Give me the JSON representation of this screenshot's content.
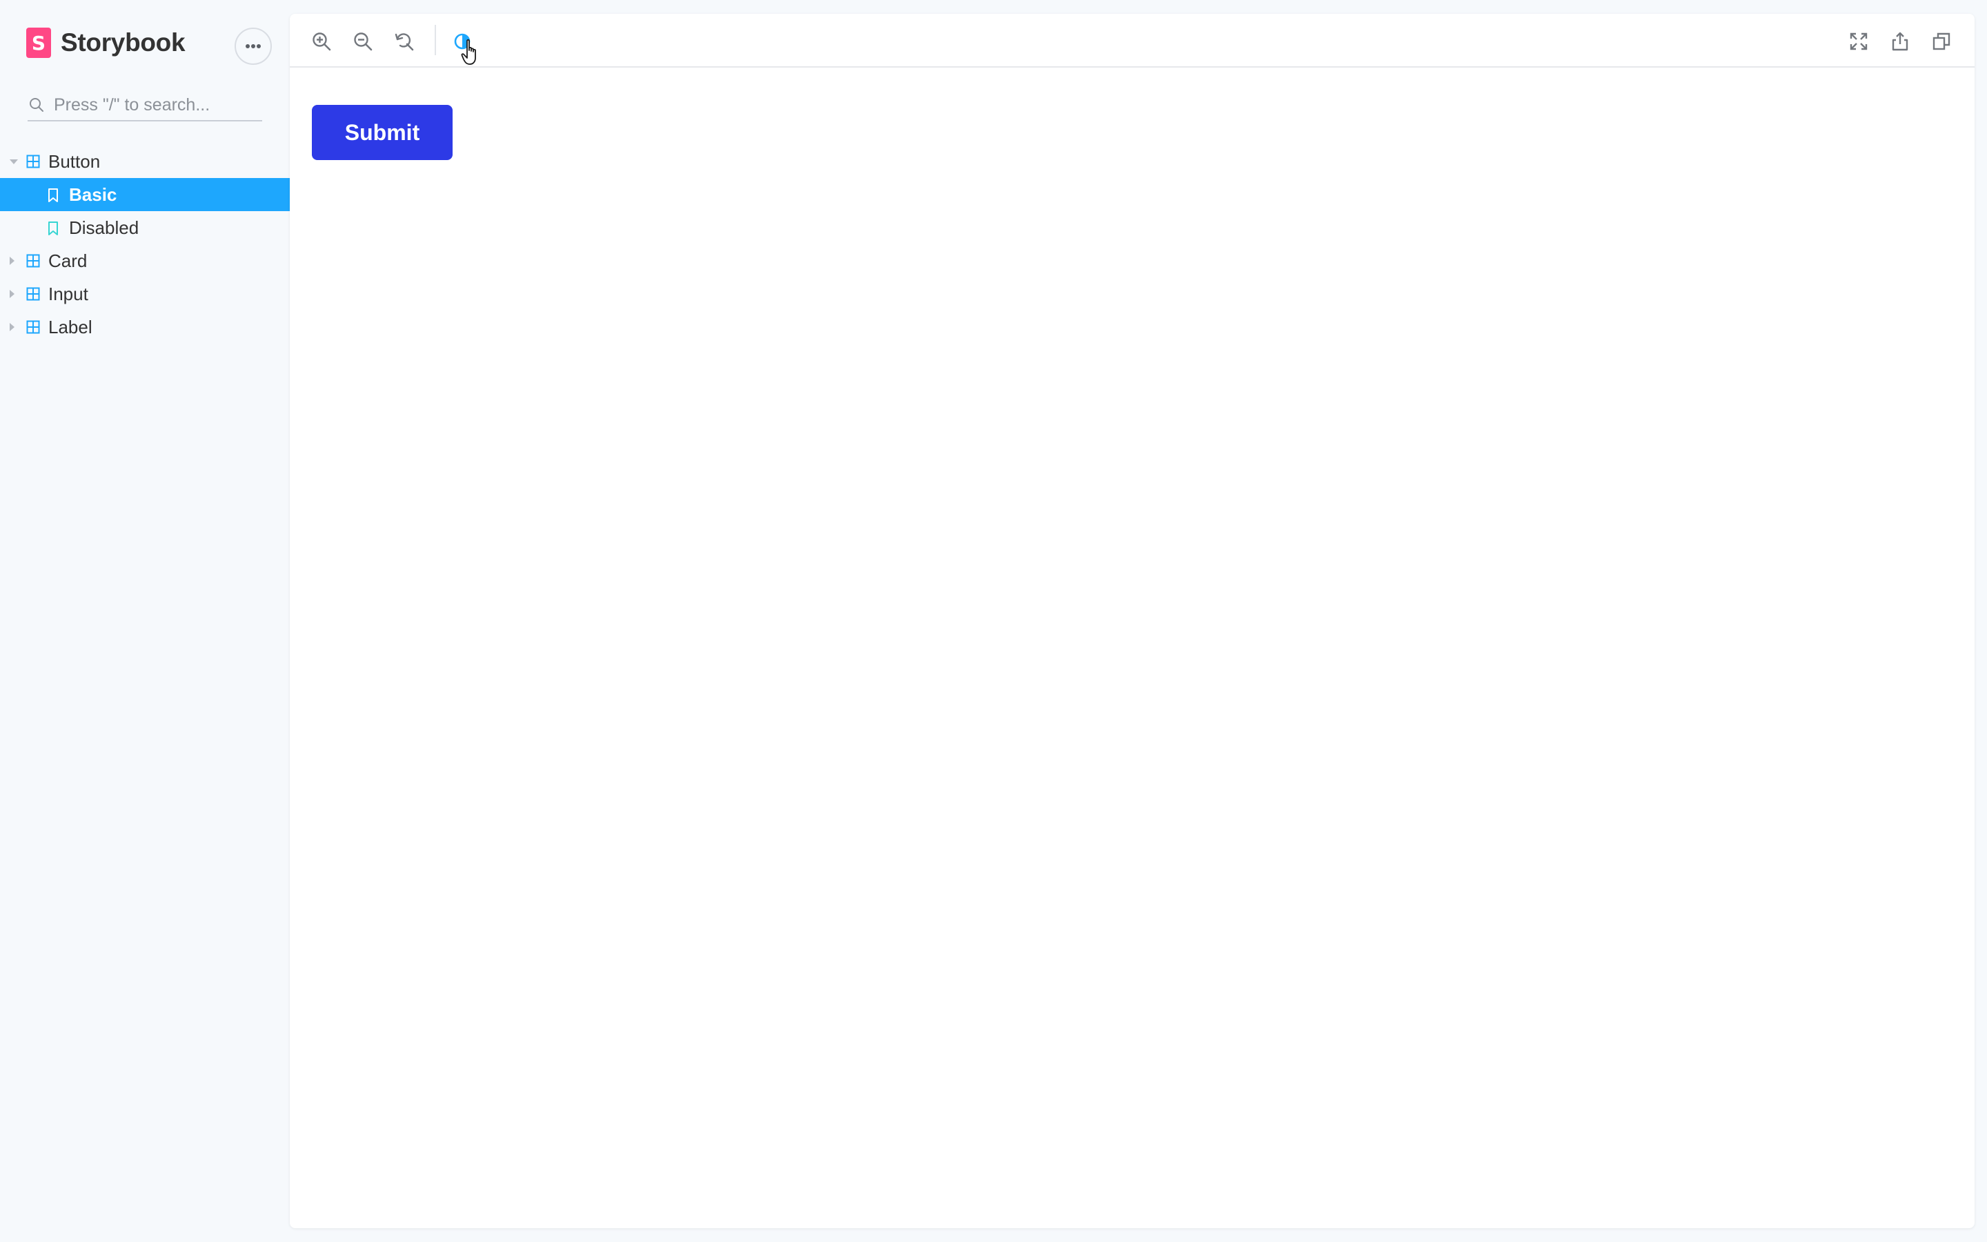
{
  "app": {
    "brand_name": "Storybook",
    "brand_logo_letter": "S"
  },
  "colors": {
    "brand": "#ff4785",
    "accent": "#1ea7fd",
    "component_icon": "#1ea7fd",
    "story_icon": "#37d5d3",
    "submit_button": "#2d3ae6"
  },
  "sidebar": {
    "menu_icon": "ellipsis-icon",
    "search": {
      "placeholder": "Press \"/\" to search...",
      "value": ""
    },
    "tree": [
      {
        "label": "Button",
        "icon": "component-icon",
        "expanded": true,
        "children": [
          {
            "label": "Basic",
            "icon": "bookmark-icon",
            "selected": true
          },
          {
            "label": "Disabled",
            "icon": "bookmark-icon",
            "selected": false
          }
        ]
      },
      {
        "label": "Card",
        "icon": "component-icon",
        "expanded": false
      },
      {
        "label": "Input",
        "icon": "component-icon",
        "expanded": false
      },
      {
        "label": "Label",
        "icon": "component-icon",
        "expanded": false
      }
    ]
  },
  "toolbar": {
    "left_tools": [
      "zoom-in-icon",
      "zoom-out-icon",
      "zoom-reset-icon",
      "background-icon"
    ],
    "right_tools": [
      "fullscreen-icon",
      "share-icon",
      "copy-icon"
    ]
  },
  "preview": {
    "submit_label": "Submit"
  }
}
